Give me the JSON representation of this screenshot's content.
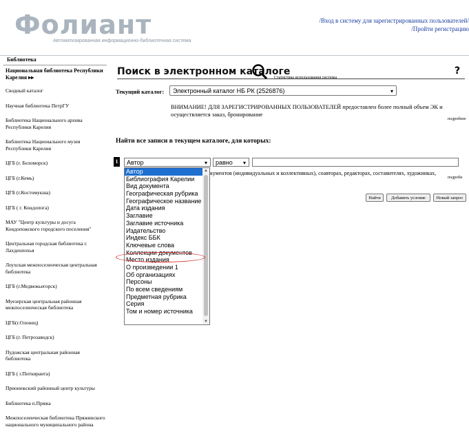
{
  "logo": {
    "name": "Фолиант",
    "subtitle": "Автоматизированная информационно-библиотечная система"
  },
  "header": {
    "login_link": "/Вход в систему для зарегистрированных пользователей/",
    "register_link": "/Пройти регистрацию"
  },
  "sidebar": {
    "title": "Библиотека",
    "items": [
      "Национальная библиотека Республики Карелия ▸▸",
      "Сводный каталог",
      "Научная библиотека ПетрГУ",
      "Библиотека Национального архива Республики Карелия",
      "Библиотека Национального музея Республики Карелия",
      "ЦГБ (г. Беломорск)",
      "ЦГБ (г.Кемь)",
      "ЦГБ (г.Костомукша)",
      "ЦГБ ( г. Кондопога)",
      "МАУ \"Центр культуры и досуга Кондопожского городского поселения\"",
      "Центральная городская библиотека г. Лахденпохья",
      "Лоухская межпоселенческая центральная библиотека",
      "ЦГБ (г.Медвежьегорск)",
      "Муезерская центральная районная межпоселенческая библиотека",
      "ЦГБ(г.Олонец)",
      "ЦГБ (г. Петрозаводск)",
      "Пудожская центральная районная библиотека",
      "ЦГБ ( г.Питкяранта)",
      "Прионежский районный центр культуры",
      "Библиотека п.Пряжа",
      "Межпоселенческая библиотека Пряжинского национального муниципального района"
    ]
  },
  "main": {
    "title": "Поиск в электронном каталоге",
    "stats_link": "Статистика использования системы",
    "help": "?",
    "current_catalog_label": "Текущий каталог:",
    "current_catalog_value": "Электронный каталог НБ РК (2526876)",
    "warning": "ВНИМАНИЕ! ДЛЯ ЗАРЕГИСТРИРОВАННЫХ ПОЛЬЗОВАТЕЛЕЙ предоставлен более полный объем ЭК и осуществляется заказ, бронирование",
    "more_link": "подробнее",
    "find_all": "Найти все записи в текущем каталоге, для которых:",
    "row_number": "1",
    "field_value": "Автор",
    "operator_value": "равно",
    "hint": "кументов (индивидуальных и коллективных), соавторах, редакторах, составителях, художниках,",
    "more_link2": "подробн",
    "buttons": {
      "find": "Найти",
      "add": "Добавить условие",
      "new": "Новый запрос"
    }
  },
  "dropdown": {
    "options": [
      "Автор",
      "Библиография Карелии",
      "Вид документа",
      "Географическая рубрика",
      "Географическое название",
      "Дата издания",
      "Заглавие",
      "Заглавие источника",
      "Издательство",
      "Индекс ББК",
      "Ключевые слова",
      "Коллекции документов",
      "Место издания",
      "О произведении 1",
      "Об организациях",
      "Персоны",
      "По всем сведениям",
      "Предметная рубрика",
      "Серия",
      "Том и номер источника"
    ],
    "selected": "Автор",
    "highlighted": "Коллекции документов"
  },
  "colors": {
    "link": "#1a3ea0",
    "selection": "#1e6fd0",
    "annotation": "#d93030"
  }
}
